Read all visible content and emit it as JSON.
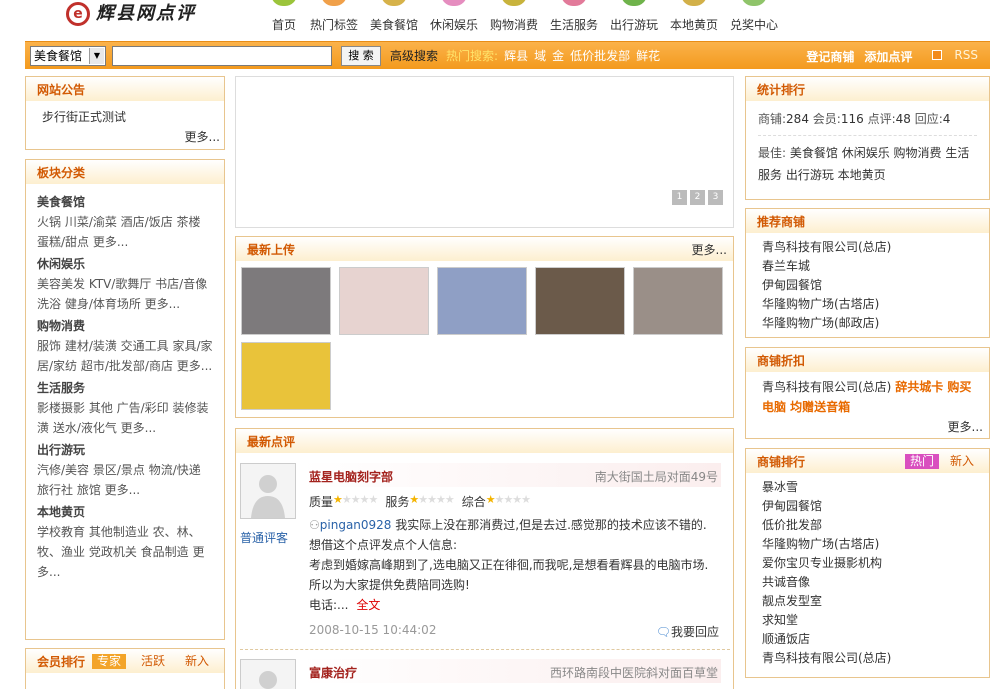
{
  "header": {
    "logo_text": "辉县网点评",
    "nav": [
      {
        "label": "首页",
        "icon": "home-icon",
        "color": "#9bc43b"
      },
      {
        "label": "热门标签",
        "icon": "tag-icon",
        "color": "#f0a04a"
      },
      {
        "label": "美食餐馆",
        "icon": "food-icon",
        "color": "#d6b24a"
      },
      {
        "label": "休闲娱乐",
        "icon": "leisure-icon",
        "color": "#e58dbf"
      },
      {
        "label": "购物消费",
        "icon": "shopping-icon",
        "color": "#c8b33c"
      },
      {
        "label": "生活服务",
        "icon": "service-icon",
        "color": "#e27a9a"
      },
      {
        "label": "出行游玩",
        "icon": "travel-icon",
        "color": "#6fb34b"
      },
      {
        "label": "本地黄页",
        "icon": "yellowpage-icon",
        "color": "#d2b049"
      },
      {
        "label": "兑奖中心",
        "icon": "prize-icon",
        "color": "#8fc46a"
      }
    ]
  },
  "search": {
    "category_value": "美食餐馆",
    "input_value": "",
    "button_label": "搜 索",
    "advanced_label": "高级搜索",
    "hot_label": "热门搜索:",
    "hot_words": [
      "辉县",
      "域",
      "金",
      "低价批发部",
      "鲜花"
    ],
    "register_label": "登记商铺",
    "add_review_label": "添加点评",
    "rss_label": "RSS"
  },
  "notice": {
    "title": "网站公告",
    "items": [
      "步行街正式测试"
    ],
    "more": "更多..."
  },
  "categories": {
    "title": "板块分类",
    "groups": [
      {
        "name": "美食餐馆",
        "text": "火锅 川菜/渝菜 酒店/饭店 茶楼 蛋糕/甜点 更多..."
      },
      {
        "name": "休闲娱乐",
        "text": "美容美发 KTV/歌舞厅 书店/音像 洗浴 健身/体育场所 更多..."
      },
      {
        "name": "购物消费",
        "text": "服饰 建材/装潢 交通工具 家具/家居/家纺 超市/批发部/商店 更多..."
      },
      {
        "name": "生活服务",
        "text": "影楼摄影 其他 广告/彩印 装修装潢 送水/液化气 更多..."
      },
      {
        "name": "出行游玩",
        "text": "汽修/美容 景区/景点 物流/快递 旅行社 旅馆 更多..."
      },
      {
        "name": "本地黄页",
        "text": "学校教育 其他制造业 农、林、牧、渔业 党政机关 食品制造 更多..."
      }
    ]
  },
  "member_rank": {
    "title": "会员排行",
    "tabs": [
      "专家",
      "活跃",
      "新入"
    ]
  },
  "slideshow": {
    "pages": [
      "1",
      "2",
      "3"
    ]
  },
  "uploads": {
    "title": "最新上传",
    "more": "更多...",
    "photos": [
      {
        "name": "storefront-photo",
        "bg": "#7d7a7c"
      },
      {
        "name": "sign-numbers-photo",
        "bg": "#e7d3d0"
      },
      {
        "name": "logo-sign-photo",
        "bg": "#8f9fc5"
      },
      {
        "name": "switch-panel-photo",
        "bg": "#6b5a4a"
      },
      {
        "name": "shop-front-photo",
        "bg": "#9a8f88"
      },
      {
        "name": "flyer-photo",
        "bg": "#e9c33a"
      }
    ]
  },
  "reviews": {
    "title": "最新点评",
    "items": [
      {
        "shop": "蓝星电脑刻字部",
        "address": "南大街国土局对面49号",
        "quality_label": "质量",
        "service_label": "服务",
        "overall_label": "综合",
        "reviewer_type": "普通评客",
        "user": "pingan0928",
        "content_lines": [
          "我实际上没在那消费过,但是去过.感觉那的技术应该不错的.",
          "想借这个点评发点个人信息:",
          "考虑到婚嫁高峰期到了,选电脑又正在徘徊,而我呢,是想看看辉县的电脑市场.",
          "所以为大家提供免费陪同选购!",
          "电话:..."
        ],
        "full_text_link": "全文",
        "time": "2008-10-15 10:44:02",
        "reply_label": "我要回应"
      },
      {
        "shop": "富康治疗",
        "address": "西环路南段中医院斜对面百草堂"
      }
    ]
  },
  "stats": {
    "title": "统计排行",
    "shops_label": "商铺:",
    "shops": "284",
    "members_label": "会员:",
    "members": "116",
    "reviews_label": "点评:",
    "reviews": "48",
    "replies_label": "回应:",
    "replies": "4",
    "best_label": "最佳:",
    "best_text": "美食餐馆 休闲娱乐 购物消费 生活服务 出行游玩 本地黄页"
  },
  "recommended": {
    "title": "推荐商铺",
    "items": [
      "青鸟科技有限公司(总店)",
      "春兰车城",
      "伊甸园餐馆",
      "华隆购物广场(古塔店)",
      "华隆购物广场(邮政店)"
    ]
  },
  "discount": {
    "title": "商铺折扣",
    "shop": "青鸟科技有限公司(总店)",
    "promo": "辞共城卡 购买电脑 均赠送音箱",
    "more": "更多..."
  },
  "shop_rank": {
    "title": "商铺排行",
    "tabs": [
      "热门",
      "新入"
    ],
    "items": [
      "暴冰雪",
      "伊甸园餐馆",
      "低价批发部",
      "华隆购物广场(古塔店)",
      "爱你宝贝专业摄影机构",
      "共诚音像",
      "靓点发型室",
      "求知堂",
      "顺通饭店",
      "青鸟科技有限公司(总店)"
    ]
  }
}
